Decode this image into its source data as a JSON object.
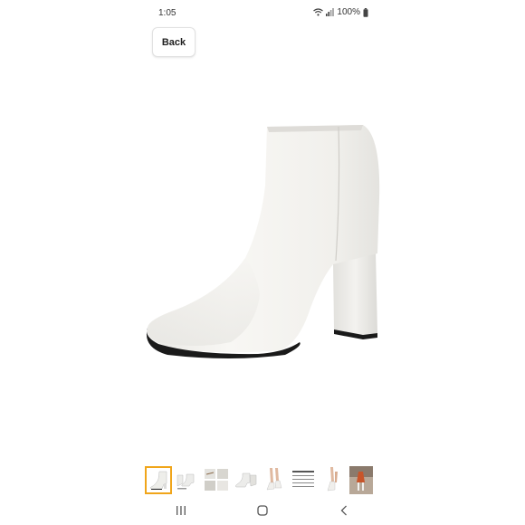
{
  "status_bar": {
    "time": "1:05",
    "battery": "100%",
    "icons": [
      "wifi-icon",
      "signal-icon",
      "battery-icon"
    ]
  },
  "header": {
    "back_label": "Back"
  },
  "product": {
    "image": "white-pointed-toe-block-heel-ankle-boot"
  },
  "thumbnails": {
    "count": 8,
    "selected_index": 0
  },
  "nav_bar": {
    "icons": [
      "recent-apps-icon",
      "home-icon",
      "back-nav-icon"
    ]
  },
  "colors": {
    "selected_thumb_border": "#f0a51a",
    "boot_white": "#f3f2ef",
    "sole_black": "#1a1a1a"
  }
}
